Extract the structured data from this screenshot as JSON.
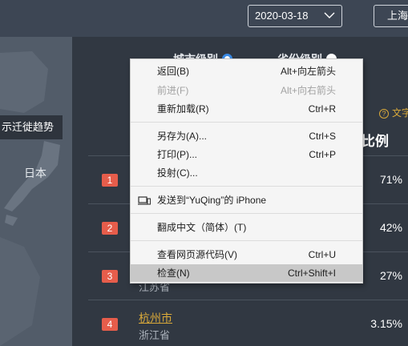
{
  "topbar": {
    "date": "2020-03-18",
    "city_partial": "上海"
  },
  "map": {
    "trend_button_partial": "示迁徙趋势",
    "country_label": "日本"
  },
  "ranking": {
    "city_level_label": "城市级别",
    "province_level_label": "省份级别",
    "help_partial": "文字",
    "ratio_header_partial": "比例",
    "rows": [
      {
        "rank": "1",
        "city": "",
        "province": "",
        "ratio": "71%"
      },
      {
        "rank": "2",
        "city": "",
        "province": "",
        "ratio": "42%"
      },
      {
        "rank": "3",
        "city": "",
        "province": "江苏省",
        "ratio": "27%"
      },
      {
        "rank": "4",
        "city": "杭州市",
        "province": "浙江省",
        "ratio": "3.15%"
      }
    ]
  },
  "context_menu": {
    "groups": [
      [
        {
          "label": "返回(B)",
          "shortcut": "Alt+向左箭头",
          "disabled": false
        },
        {
          "label": "前进(F)",
          "shortcut": "Alt+向右箭头",
          "disabled": true
        },
        {
          "label": "重新加载(R)",
          "shortcut": "Ctrl+R",
          "disabled": false
        }
      ],
      [
        {
          "label": "另存为(A)...",
          "shortcut": "Ctrl+S",
          "disabled": false
        },
        {
          "label": "打印(P)...",
          "shortcut": "Ctrl+P",
          "disabled": false
        },
        {
          "label": "投射(C)...",
          "shortcut": "",
          "disabled": false
        }
      ],
      [
        {
          "label": "发送到“YuQing”的 iPhone",
          "shortcut": "",
          "icon": "devices-icon"
        }
      ],
      [
        {
          "label": "翻成中文（简体）(T)",
          "shortcut": ""
        }
      ],
      [
        {
          "label": "查看网页源代码(V)",
          "shortcut": "Ctrl+U"
        },
        {
          "label": "检查(N)",
          "shortcut": "Ctrl+Shift+I",
          "highlighted": true
        }
      ]
    ]
  },
  "colors": {
    "accent_blue": "#3a8be6",
    "gold": "#d9a93a",
    "rank_badge": "#e65d4b",
    "menu_highlight": "#c8c8c8"
  }
}
